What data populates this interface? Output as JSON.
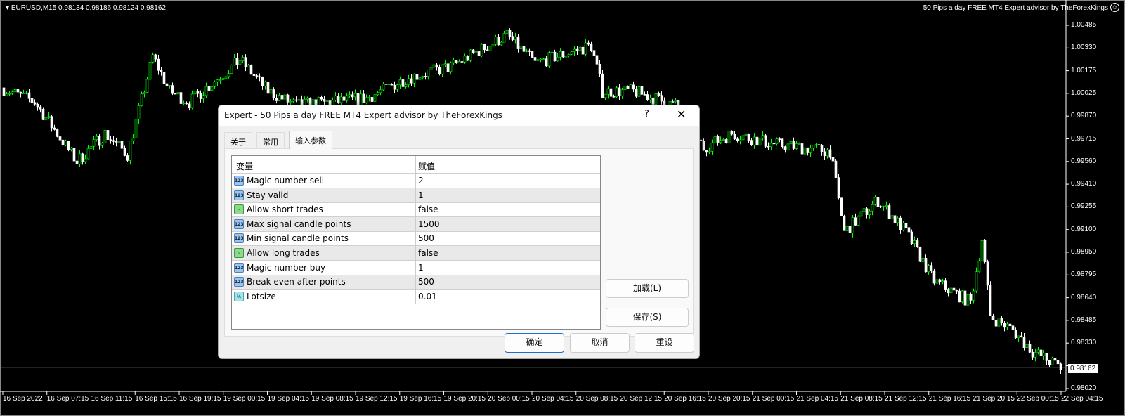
{
  "chart_header": {
    "symbol": "EURUSD,M15  0.98134 0.98186 0.98124 0.98162",
    "ea_name": "50 Pips a day FREE MT4 Expert advisor by TheForexKings"
  },
  "colors": {
    "bull": "#00ff00",
    "bear": "#ffffff",
    "bg": "#000000"
  },
  "chart_data": {
    "type": "candlestick",
    "symbol": "EURUSD",
    "timeframe": "M15",
    "current_price": "0.98162",
    "y_ticks": [
      "1.00485",
      "1.00330",
      "1.00175",
      "1.00025",
      "0.99870",
      "0.99715",
      "0.99560",
      "0.99410",
      "0.99255",
      "0.99100",
      "0.98950",
      "0.98795",
      "0.98640",
      "0.98485",
      "0.98330",
      "0.98162",
      "0.98020"
    ],
    "ylim": [
      0.9802,
      1.00485
    ],
    "x_ticks": [
      "16 Sep 2022",
      "16 Sep 07:15",
      "16 Sep 11:15",
      "16 Sep 15:15",
      "16 Sep 19:15",
      "19 Sep 00:15",
      "19 Sep 04:15",
      "19 Sep 08:15",
      "19 Sep 12:15",
      "19 Sep 16:15",
      "19 Sep 20:15",
      "20 Sep 00:15",
      "20 Sep 04:15",
      "20 Sep 08:15",
      "20 Sep 12:15",
      "20 Sep 16:15",
      "20 Sep 20:15",
      "21 Sep 00:15",
      "21 Sep 04:15",
      "21 Sep 08:15",
      "21 Sep 12:15",
      "21 Sep 16:15",
      "21 Sep 20:15",
      "22 Sep 00:15",
      "22 Sep 04:15"
    ],
    "bars_per_tick": 16,
    "price_path": [
      [
        0,
        1.00061
      ],
      [
        12,
        0.99965
      ],
      [
        27,
        0.9956
      ],
      [
        37,
        0.99751
      ],
      [
        45,
        0.99608
      ],
      [
        54,
        1.00275
      ],
      [
        60,
        1.00037
      ],
      [
        67,
        0.99965
      ],
      [
        85,
        1.00251
      ],
      [
        95,
        1.00037
      ],
      [
        105,
        0.99941
      ],
      [
        130,
        0.99989
      ],
      [
        145,
        1.00132
      ],
      [
        160,
        1.00204
      ],
      [
        180,
        1.00418
      ],
      [
        190,
        1.00228
      ],
      [
        210,
        1.00347
      ],
      [
        214,
        1.00037
      ],
      [
        225,
        1.00037
      ],
      [
        240,
        0.99941
      ],
      [
        250,
        0.99655
      ],
      [
        260,
        0.99751
      ],
      [
        275,
        0.99679
      ],
      [
        295,
        0.99632
      ],
      [
        300,
        0.99083
      ],
      [
        312,
        0.99298
      ],
      [
        322,
        0.99083
      ],
      [
        332,
        0.9875
      ],
      [
        345,
        0.98606
      ],
      [
        349,
        0.99036
      ],
      [
        352,
        0.98511
      ],
      [
        360,
        0.98416
      ],
      [
        367,
        0.98273
      ],
      [
        377,
        0.98162
      ]
    ]
  },
  "dialog": {
    "title": "Expert - 50 Pips a day FREE MT4 Expert advisor by TheForexKings",
    "help": "?",
    "close": "✕",
    "tabs": [
      "关于",
      "常用",
      "输入参数"
    ],
    "columns": [
      "变量",
      "赋值"
    ],
    "params": [
      {
        "name": "Magic number sell",
        "value": "2",
        "type": "int",
        "icon": "123"
      },
      {
        "name": "Stay valid",
        "value": "1",
        "type": "int",
        "icon": "123"
      },
      {
        "name": "Allow short trades",
        "value": "false",
        "type": "bool",
        "icon": "~"
      },
      {
        "name": "Max signal candle points",
        "value": "1500",
        "type": "int",
        "icon": "123"
      },
      {
        "name": "Min signal candle points",
        "value": "500",
        "type": "int",
        "icon": "123"
      },
      {
        "name": "Allow long trades",
        "value": "false",
        "type": "bool",
        "icon": "~"
      },
      {
        "name": "Magic number buy",
        "value": "1",
        "type": "int",
        "icon": "123"
      },
      {
        "name": "Break even after points",
        "value": "500",
        "type": "int",
        "icon": "123"
      },
      {
        "name": "Lotsize",
        "value": "0.01",
        "type": "double",
        "icon": "½"
      }
    ],
    "load": "加载(L)",
    "save": "保存(S)",
    "ok": "确定",
    "cancel": "取消",
    "reset": "重设"
  }
}
